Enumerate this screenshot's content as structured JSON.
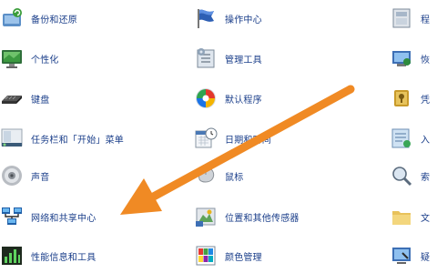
{
  "left": [
    {
      "label": "备份和还原",
      "icon": "backup-restore-icon"
    },
    {
      "label": "个性化",
      "icon": "personalization-icon"
    },
    {
      "label": "键盘",
      "icon": "keyboard-icon"
    },
    {
      "label": "任务栏和「开始」菜单",
      "icon": "taskbar-icon"
    },
    {
      "label": "声音",
      "icon": "sound-icon"
    },
    {
      "label": "网络和共享中心",
      "icon": "network-icon"
    },
    {
      "label": "性能信息和工具",
      "icon": "performance-icon"
    }
  ],
  "middle": [
    {
      "label": "操作中心",
      "icon": "action-center-flag-icon"
    },
    {
      "label": "管理工具",
      "icon": "admin-tools-icon"
    },
    {
      "label": "默认程序",
      "icon": "default-programs-icon"
    },
    {
      "label": "日期和时间",
      "icon": "date-time-icon"
    },
    {
      "label": "鼠标",
      "icon": "mouse-icon"
    },
    {
      "label": "位置和其他传感器",
      "icon": "location-sensors-icon"
    },
    {
      "label": "颜色管理",
      "icon": "color-management-icon"
    }
  ],
  "right": [
    {
      "label": "程",
      "icon": "programs-icon"
    },
    {
      "label": "恢",
      "icon": "recovery-icon"
    },
    {
      "label": "凭",
      "icon": "credentials-icon"
    },
    {
      "label": "入",
      "icon": "getting-started-icon"
    },
    {
      "label": "索",
      "icon": "indexing-icon"
    },
    {
      "label": "文",
      "icon": "folder-options-icon"
    },
    {
      "label": "疑",
      "icon": "troubleshooting-icon"
    }
  ],
  "colors": {
    "link": "#1a3e8a",
    "arrow": "#f08a24"
  }
}
